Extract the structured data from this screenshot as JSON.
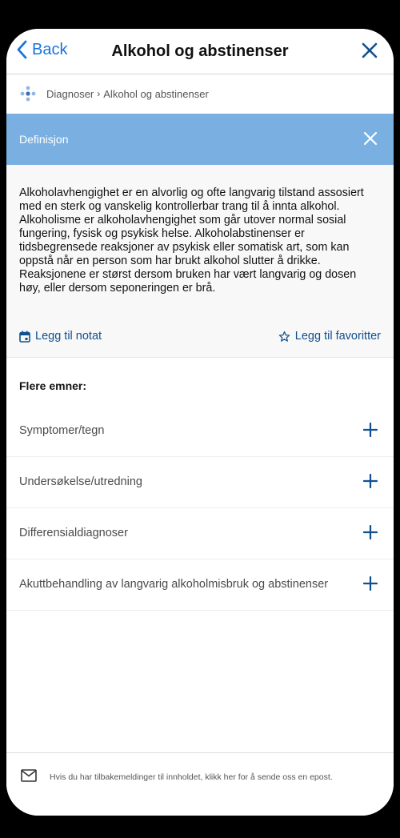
{
  "nav": {
    "back_label": "Back",
    "title": "Alkohol og abstinenser"
  },
  "breadcrumb": {
    "root": "Diagnoser",
    "current": "Alkohol og abstinenser"
  },
  "definition": {
    "label": "Definisjon",
    "text": "Alkoholavhengighet er en alvorlig og ofte langvarig tilstand assosiert med en sterk og vanskelig kontrollerbar trang til å innta alkohol. Alkoholisme er alkoholavhengighet som går utover normal sosial fungering, fysisk og psykisk helse. Alkoholabstinenser er tidsbegrensede reaksjoner av psykisk eller somatisk art, som kan oppstå når en person som har brukt alkohol slutter å drikke. Reaksjonene er størst dersom bruken har vært langvarig og dosen høy, eller dersom seponeringen er brå."
  },
  "actions": {
    "add_note": "Legg til notat",
    "add_favorite": "Legg til favoritter"
  },
  "more": {
    "title": "Flere emner:",
    "topics": [
      {
        "label": "Symptomer/tegn"
      },
      {
        "label": "Undersøkelse/utredning"
      },
      {
        "label": "Differensialdiagnoser"
      },
      {
        "label": "Akuttbehandling av langvarig alkoholmisbruk og abstinenser"
      }
    ]
  },
  "footer": {
    "text": "Hvis du har tilbakemeldinger til innholdet, klikk her for å sende oss en epost."
  },
  "colors": {
    "accent": "#1a73d9",
    "definition_bar": "#7ab0e1",
    "link": "#10508f"
  }
}
